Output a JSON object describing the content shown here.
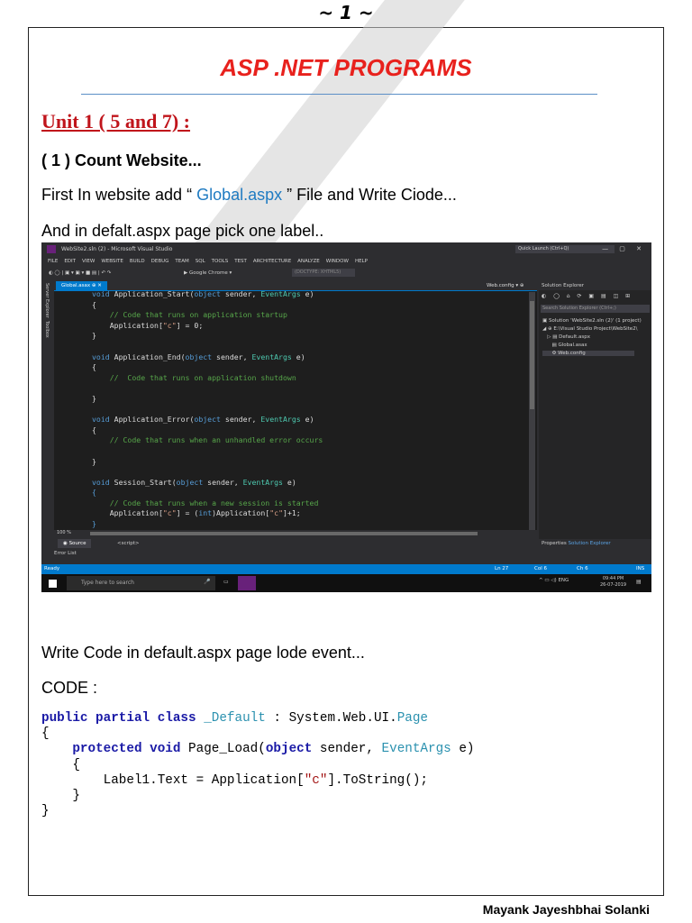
{
  "page_number": "~ 1 ~",
  "title": "ASP .NET PROGRAMS",
  "unit_heading": "Unit 1 ( 5 and 7) :",
  "section_heading": "( 1 ) Count Website...",
  "para1": {
    "before": "First In website add “ ",
    "link": "Global.aspx",
    "after": " ” File and Write Ciode..."
  },
  "para2": "And in defalt.aspx page pick one label..",
  "screenshot": {
    "window_title": "WebSite2.sln (2) - Microsoft Visual Studio",
    "quick_launch": "Quick Launch (Ctrl+Q)",
    "menus": [
      "FILE",
      "EDIT",
      "VIEW",
      "WEBSITE",
      "BUILD",
      "DEBUG",
      "TEAM",
      "SQL",
      "TOOLS",
      "TEST",
      "ARCHITECTURE",
      "ANALYZE",
      "WINDOW",
      "HELP"
    ],
    "run_target": "Google Chrome",
    "doctype": "(DOCTYPE: XHTML5)",
    "left_tabs": [
      "Server Explorer",
      "Toolbox"
    ],
    "active_tab": "Global.asax",
    "right_tab": "Web.config",
    "code": {
      "l1_void": "void",
      "l1_name": " Application_Start(",
      "l1_obj": "object",
      "l1_mid": " sender, ",
      "l1_type": "EventArgs",
      "l1_end": " e)",
      "brace_open": "{",
      "brace_close": "}",
      "c1": "// Code that runs on application startup",
      "s1_a": "Application[",
      "s1_str": "\"c\"",
      "s1_b": "] = 0;",
      "l2_name": " Application_End(",
      "c2": "//  Code that runs on application shutdown",
      "l3_name": " Application_Error(",
      "c3": "// Code that runs when an unhandled error occurs",
      "l4_name": " Session_Start(",
      "c4": "// Code that runs when a new session is started",
      "s4_a": "Application[",
      "s4_str": "\"c\"",
      "s4_b": "] = (",
      "s4_int": "int",
      "s4_c": ")Application[",
      "s4_d": "]+1;"
    },
    "zoom": "100 %",
    "source_button": "Source",
    "script_tag": "<script>",
    "error_list": "Error List",
    "solution_explorer": {
      "title": "Solution Explorer",
      "search": "Search Solution Explorer (Ctrl+;)",
      "solution": "Solution 'WebSite2.sln (2)' (1 project)",
      "project": "E:\\Visual Studio Project\\WebSite2\\",
      "items": [
        "Default.aspx",
        "Global.asax",
        "Web.config"
      ],
      "footer_tab1": "Properties",
      "footer_tab2": "Solution Explorer"
    },
    "status": {
      "ready": "Ready",
      "ln": "Ln 27",
      "col": "Col 6",
      "ch": "Ch 6",
      "ins": "INS"
    },
    "taskbar": {
      "search": "Type here to search",
      "lang": "ENG",
      "time": "09:44 PM",
      "date": "26-07-2019"
    }
  },
  "para3": "Write Code in default.aspx page lode event...",
  "code_label": "CODE :",
  "listing": {
    "l1_a": "public partial class",
    "l1_b": "_Default",
    "l1_c": " : System.Web.UI.",
    "l1_d": "Page",
    "open": "{",
    "l3_a": "protected void",
    "l3_b": " Page_Load(",
    "l3_c": "object",
    "l3_d": " sender, ",
    "l3_e": "EventArgs",
    "l3_f": " e)",
    "l5_a": "Label1.Text = Application[",
    "l5_b": "\"c\"",
    "l5_c": "].ToString();",
    "close": "}"
  },
  "author": "Mayank Jayeshbhai Solanki"
}
